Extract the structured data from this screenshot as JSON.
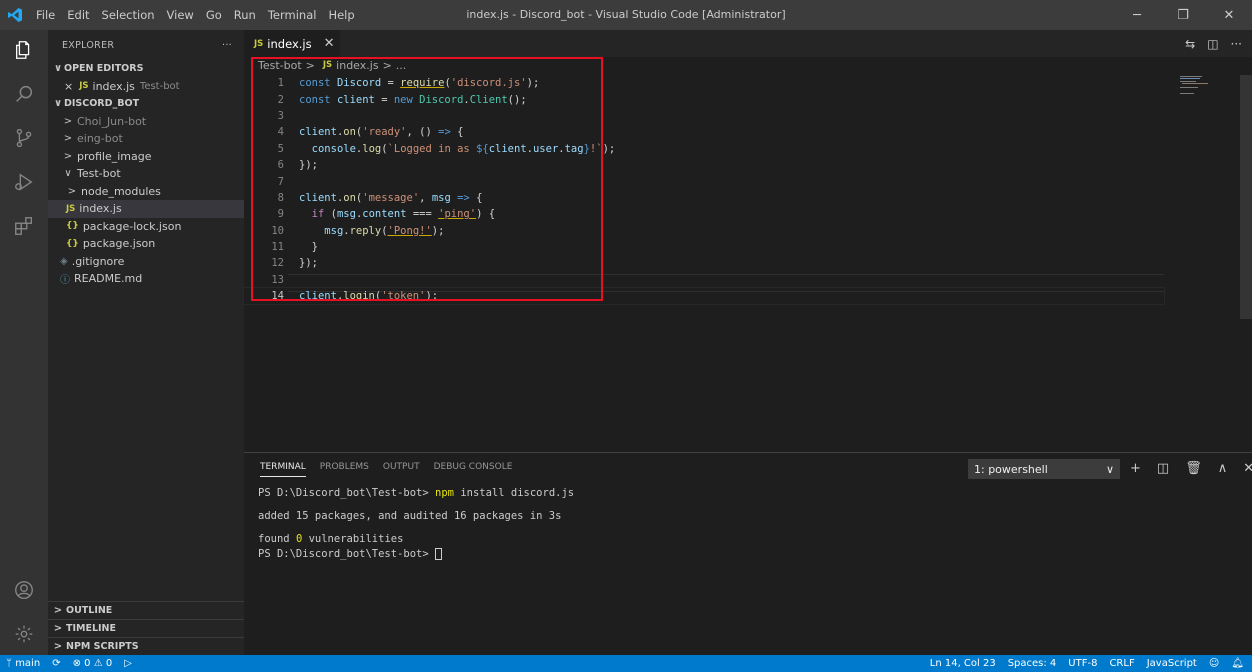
{
  "window": {
    "title": "index.js - Discord_bot - Visual Studio Code [Administrator]",
    "menu": [
      "File",
      "Edit",
      "Selection",
      "View",
      "Go",
      "Run",
      "Terminal",
      "Help"
    ]
  },
  "colors": {
    "titlebar": "#3c3c3c",
    "activitybar": "#333333",
    "sidebar": "#252526",
    "editor": "#1e1e1e",
    "statusbar": "#007acc",
    "highlight_box": "#e81123"
  },
  "explorer": {
    "header": "EXPLORER",
    "more": "···",
    "open_editors_label": "OPEN EDITORS",
    "open_editor_close": "×",
    "open_editor_file": "index.js",
    "open_editor_folder": "Test-bot",
    "root_label": "DISCORD_BOT",
    "tree": [
      {
        "name": "Choi_Jun-bot",
        "chev": ">"
      },
      {
        "name": "eing-bot",
        "chev": ">"
      },
      {
        "name": "profile_image",
        "chev": ">"
      },
      {
        "name": "Test-bot",
        "chev": "∨"
      },
      {
        "name": "node_modules",
        "chev": ">"
      },
      {
        "name": "index.js",
        "badge": "JS"
      },
      {
        "name": "package-lock.json",
        "badge": "{}"
      },
      {
        "name": "package.json",
        "badge": "{}"
      },
      {
        "name": ".gitignore",
        "badge": "◈"
      },
      {
        "name": "README.md",
        "badge": "ⓘ"
      }
    ],
    "bottom_sections": [
      "OUTLINE",
      "TIMELINE",
      "NPM SCRIPTS"
    ]
  },
  "editor": {
    "tab_label": "index.js",
    "tab_badge": "JS",
    "breadcrumb": {
      "folder": "Test-bot",
      "file": "index.js",
      "tail": "..."
    },
    "line_numbers": [
      "1",
      "2",
      "3",
      "4",
      "5",
      "6",
      "7",
      "8",
      "9",
      "10",
      "11",
      "12",
      "13",
      "14"
    ],
    "cursor_line": 14
  },
  "panel": {
    "tabs": [
      "TERMINAL",
      "PROBLEMS",
      "OUTPUT",
      "DEBUG CONSOLE"
    ],
    "terminal_select": "1: powershell",
    "prompt": "PS D:\\Discord_bot\\Test-bot>",
    "command_npm": "npm",
    "command_rest": "install discord.js",
    "line_added": "added 15 packages, and audited 16 packages in 3s",
    "line_found_a": "found",
    "line_found_zero": "0",
    "line_found_b": "vulnerabilities"
  },
  "statusbar": {
    "branch": "main",
    "errors": "0",
    "warnings": "0",
    "position": "Ln 14, Col 23",
    "spaces": "Spaces: 4",
    "encoding": "UTF-8",
    "eol": "CRLF",
    "language": "JavaScript"
  }
}
